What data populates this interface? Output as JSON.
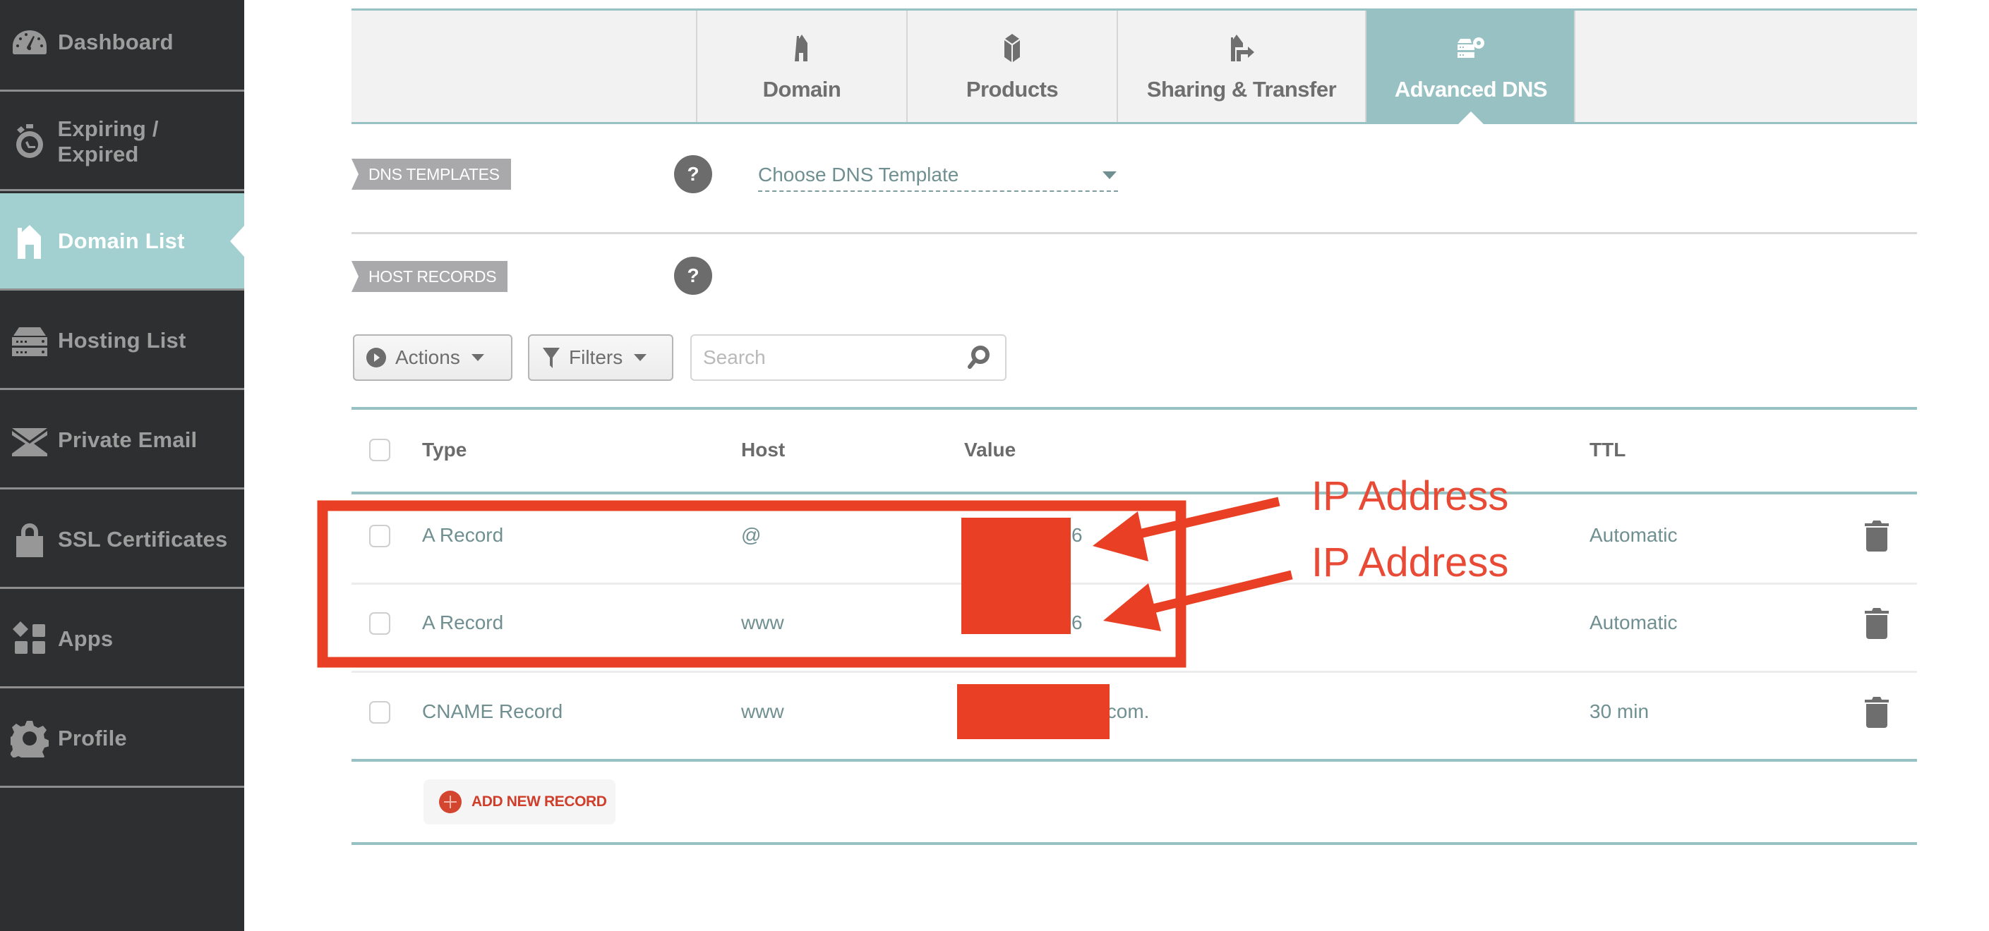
{
  "sidebar": {
    "items": [
      {
        "label": "Dashboard",
        "icon": "dashboard-gauge-icon",
        "active": false
      },
      {
        "label": "Expiring / Expired",
        "icon": "stopwatch-icon",
        "active": false
      },
      {
        "label": "Domain List",
        "icon": "home-icon",
        "active": true
      },
      {
        "label": "Hosting List",
        "icon": "server-icon",
        "active": false
      },
      {
        "label": "Private Email",
        "icon": "envelope-icon",
        "active": false
      },
      {
        "label": "SSL Certificates",
        "icon": "lock-icon",
        "active": false
      },
      {
        "label": "Apps",
        "icon": "apps-grid-icon",
        "active": false
      },
      {
        "label": "Profile",
        "icon": "gear-icon",
        "active": false
      }
    ]
  },
  "tabs": [
    {
      "label": "Domain",
      "icon": "house-icon",
      "active": false
    },
    {
      "label": "Products",
      "icon": "box-icon",
      "active": false
    },
    {
      "label": "Sharing & Transfer",
      "icon": "house-transfer-icon",
      "active": false
    },
    {
      "label": "Advanced DNS",
      "icon": "server-gear-icon",
      "active": true
    }
  ],
  "dns_templates": {
    "label": "DNS TEMPLATES",
    "help": "?",
    "select_value": "Choose DNS Template"
  },
  "host_records": {
    "label": "HOST RECORDS",
    "help": "?",
    "toolbar": {
      "actions_label": "Actions",
      "filters_label": "Filters",
      "search_placeholder": "Search"
    },
    "columns": [
      "Type",
      "Host",
      "Value",
      "TTL"
    ],
    "rows": [
      {
        "type": "A Record",
        "host": "@",
        "value_visible": "6",
        "value_redacted": true,
        "ttl": "Automatic"
      },
      {
        "type": "A Record",
        "host": "www",
        "value_visible": "6",
        "value_redacted": true,
        "ttl": "Automatic"
      },
      {
        "type": "CNAME Record",
        "host": "www",
        "value_visible": ".com.",
        "value_redacted": true,
        "ttl": "30 min"
      }
    ],
    "add_label": "ADD NEW RECORD"
  },
  "annotations": {
    "labels": [
      "IP Address",
      "IP Address"
    ],
    "color": "#e94025"
  },
  "colors": {
    "accent_teal": "#97c1c2",
    "sidebar_bg": "#2e2f31",
    "sidebar_active": "#a2cfd0",
    "add_red": "#cf3e2a"
  }
}
